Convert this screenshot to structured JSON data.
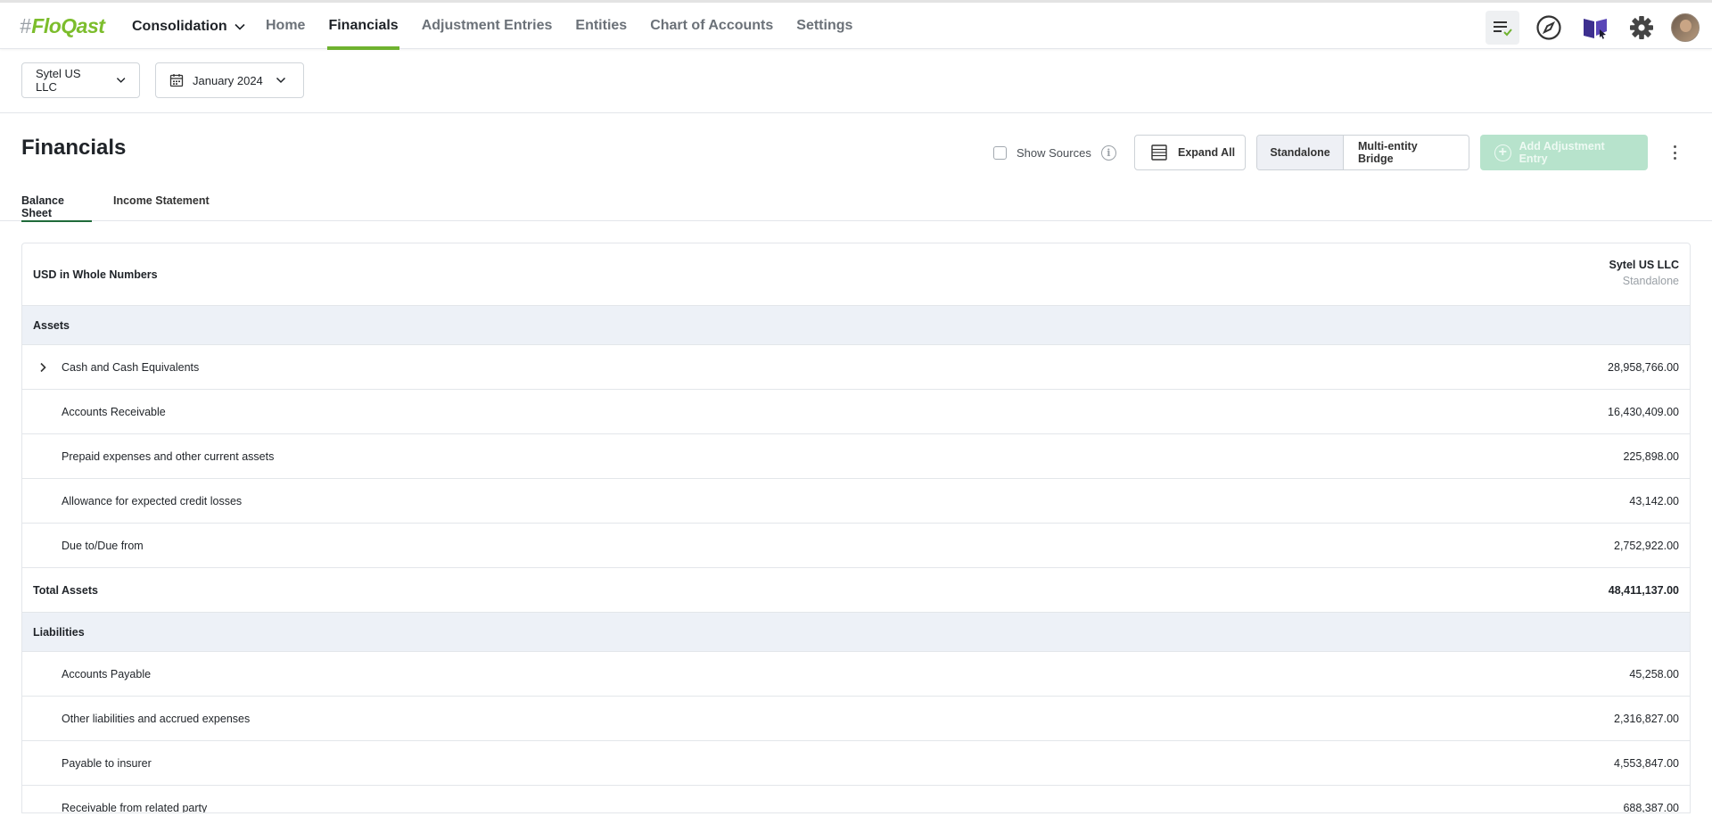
{
  "nav": {
    "logo_hash": "#",
    "logo_text": "FloQast",
    "module": "Consolidation",
    "links": [
      {
        "label": "Home"
      },
      {
        "label": "Financials"
      },
      {
        "label": "Adjustment Entries"
      },
      {
        "label": "Entities"
      },
      {
        "label": "Chart of Accounts"
      },
      {
        "label": "Settings"
      }
    ],
    "active_link": "Financials",
    "icons": [
      "task-list-icon",
      "compass-icon",
      "book-cursor-icon",
      "gear-icon",
      "avatar"
    ]
  },
  "filters": {
    "entity": "Sytel US LLC",
    "period": "January 2024"
  },
  "page": {
    "title": "Financials",
    "show_sources_label": "Show Sources",
    "show_sources_checked": false,
    "expand_all_label": "Expand All",
    "view_toggle": [
      "Standalone",
      "Multi-entity Bridge"
    ],
    "view_selected": "Standalone",
    "add_entry_label": "Add Adjustment Entry"
  },
  "tabs": [
    {
      "label": "Balance Sheet"
    },
    {
      "label": "Income Statement"
    }
  ],
  "active_tab": "Balance Sheet",
  "table": {
    "units_label": "USD in Whole Numbers",
    "column_entity": "Sytel US LLC",
    "column_view": "Standalone",
    "rows": [
      {
        "type": "section",
        "label": "Assets",
        "value": ""
      },
      {
        "type": "line",
        "label": "Cash and Cash Equivalents",
        "value": "28,958,766.00",
        "expandable": true
      },
      {
        "type": "line",
        "label": "Accounts Receivable",
        "value": "16,430,409.00"
      },
      {
        "type": "line",
        "label": "Prepaid expenses and other current assets",
        "value": "225,898.00"
      },
      {
        "type": "line",
        "label": "Allowance for expected credit losses",
        "value": "43,142.00"
      },
      {
        "type": "line",
        "label": "Due to/Due from",
        "value": "2,752,922.00"
      },
      {
        "type": "total",
        "label": "Total Assets",
        "value": "48,411,137.00"
      },
      {
        "type": "section",
        "label": "Liabilities",
        "value": ""
      },
      {
        "type": "line",
        "label": "Accounts Payable",
        "value": "45,258.00"
      },
      {
        "type": "line",
        "label": "Other liabilities and accrued expenses",
        "value": "2,316,827.00"
      },
      {
        "type": "line",
        "label": "Payable to insurer",
        "value": "4,553,847.00"
      },
      {
        "type": "line",
        "label": "Receivable from related party",
        "value": "688,387.00"
      }
    ]
  },
  "colors": {
    "brand_green": "#7cbd2c",
    "nav_active_underline": "#6fb22f",
    "tab_active_underline": "#1f6b3a",
    "section_bg": "#edf1f7",
    "add_button_disabled": "#b7e3cc"
  }
}
